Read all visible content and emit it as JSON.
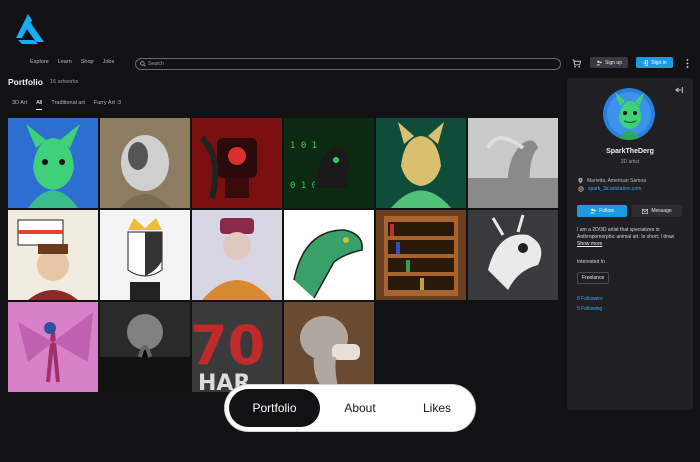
{
  "nav": [
    "Explore",
    "Learn",
    "Shop",
    "Jobs"
  ],
  "search": {
    "placeholder": "Search"
  },
  "header": {
    "signup": "Sign up",
    "signin": "Sign in"
  },
  "portfolio": {
    "title": "Portfolio",
    "count": "16 artworks",
    "filters": [
      "3D Art",
      "All",
      "Traditional art",
      "Furry Art :3"
    ],
    "active_filter": "All"
  },
  "artworks": [
    {
      "bg": "#2d6fd0",
      "accent": "#3fd07a",
      "subject": "furry-dragon-portrait"
    },
    {
      "bg": "#8d7b62",
      "accent": "#cfcfcf",
      "subject": "furry-goat-sketch"
    },
    {
      "bg": "#7a1010",
      "accent": "#d83030",
      "subject": "red-robot-creature"
    },
    {
      "bg": "#0c2a12",
      "accent": "#2fd060",
      "subject": "matrix-dragon"
    },
    {
      "bg": "#0f4d3a",
      "accent": "#52c27a",
      "subject": "furry-hoodie-portrait"
    },
    {
      "bg": "#c9c9c9",
      "accent": "#8a8a8a",
      "subject": "grey-dragon-render"
    },
    {
      "bg": "#f2ece0",
      "accent": "#e0452a",
      "subject": "boy-with-flag"
    },
    {
      "bg": "#f4f4f4",
      "accent": "#e8c030",
      "subject": "crowned-split-face"
    },
    {
      "bg": "#d9d6e4",
      "accent": "#d88a30",
      "subject": "boy-beanie-sketch"
    },
    {
      "bg": "#ffffff",
      "accent": "#3aa06a",
      "subject": "dragon-head-sketch"
    },
    {
      "bg": "#6a4020",
      "accent": "#a8642c",
      "subject": "bookshelf-render"
    },
    {
      "bg": "#3a3a3e",
      "accent": "#eaeaea",
      "subject": "white-dragon-render"
    },
    {
      "bg": "#d880c8",
      "accent": "#a0306a",
      "subject": "pink-winged-dragon"
    },
    {
      "bg": "#2a2a2a",
      "accent": "#bcbcbc",
      "subject": "dark-tree-render"
    },
    {
      "bg": "#3a3a3a",
      "accent": "#c02a2a",
      "subject": "70-hard-text"
    },
    {
      "bg": "#6a4a30",
      "accent": "#b0a8a0",
      "subject": "elephant-render"
    }
  ],
  "profile": {
    "name": "SparkTheDerg",
    "role": "3D artist",
    "location": "Marietta, American Samoa",
    "website": "spark_3d.artstation.com",
    "follow": "Follow",
    "message": "Message",
    "bio": "I am a 2D/3D artist that specializes in Anthropomorphic animal art. In short, I draw",
    "show_more": "Show more",
    "interested_in": "Interested In",
    "tag": "Freelance",
    "followers": "8 Followers",
    "following": "5 Following"
  },
  "tabs": [
    "Portfolio",
    "About",
    "Likes"
  ],
  "active_tab": "Portfolio",
  "colors": {
    "accent": "#1e9be0",
    "background": "#121215",
    "card": "#202024"
  }
}
